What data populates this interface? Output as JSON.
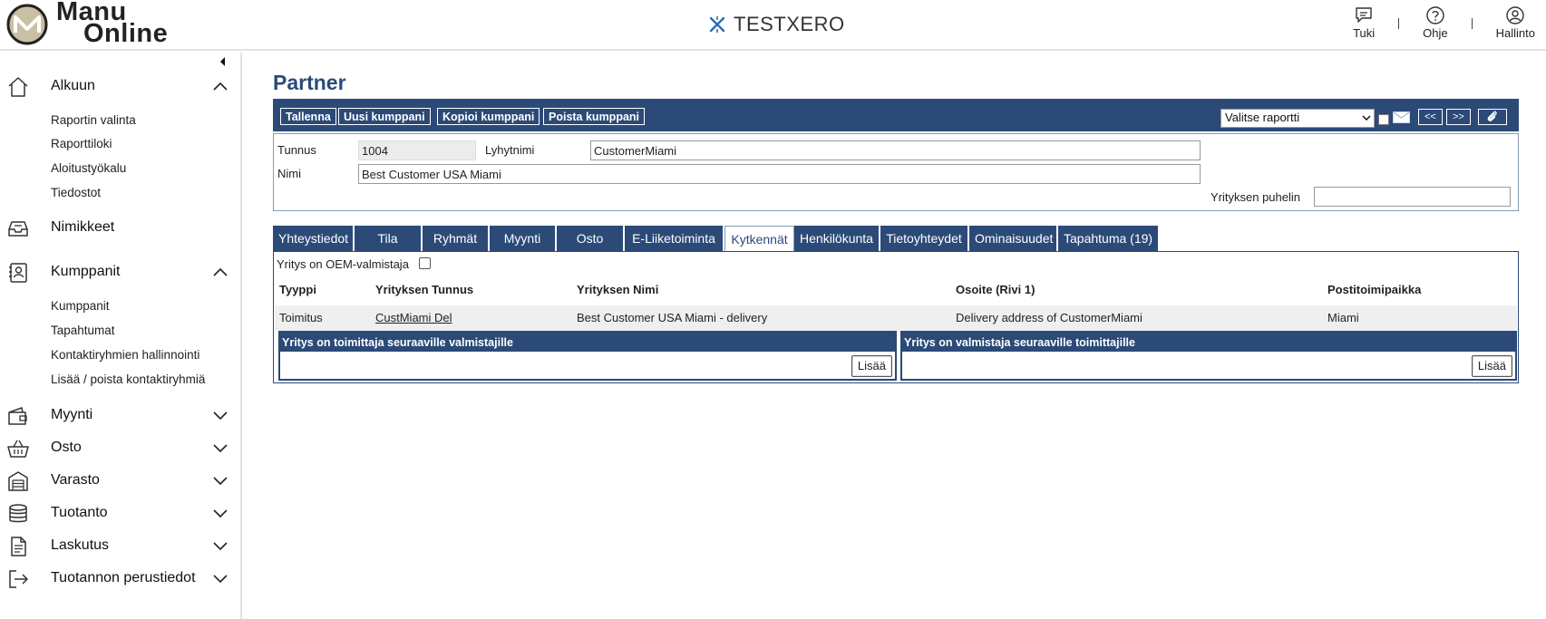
{
  "header": {
    "logo_line1": "Manu",
    "logo_line2": "Online",
    "company": "TESTXERO",
    "links": [
      {
        "label": "Tuki",
        "icon": "chat-icon"
      },
      {
        "label": "Ohje",
        "icon": "help-icon"
      },
      {
        "label": "Hallinto",
        "icon": "user-icon"
      }
    ]
  },
  "sidebar": {
    "sections": [
      {
        "label": "Alkuun",
        "icon": "home-icon",
        "expanded": true,
        "items": [
          "Raportin valinta",
          "Raporttiloki",
          "Aloitustyökalu",
          "Tiedostot"
        ]
      },
      {
        "label": "Nimikkeet",
        "icon": "inbox-icon"
      },
      {
        "label": "Kumppanit",
        "icon": "contacts-icon",
        "expanded": true,
        "items": [
          "Kumppanit",
          "Tapahtumat",
          "Kontaktiryhmien hallinnointi",
          "Lisää / poista kontaktiryhmiä"
        ]
      },
      {
        "label": "Myynti",
        "icon": "wallet-icon"
      },
      {
        "label": "Osto",
        "icon": "basket-icon"
      },
      {
        "label": "Varasto",
        "icon": "warehouse-icon"
      },
      {
        "label": "Tuotanto",
        "icon": "database-icon"
      },
      {
        "label": "Laskutus",
        "icon": "document-icon"
      },
      {
        "label": "Tuotannon perustiedot",
        "icon": "exit-icon"
      }
    ]
  },
  "page": {
    "title": "Partner"
  },
  "toolbar": {
    "save": "Tallenna",
    "new": "Uusi kumppani",
    "copy": "Kopioi kumppani",
    "delete": "Poista kumppani",
    "report_select": "Valitse raportti",
    "prev": "<<",
    "next": ">>"
  },
  "form": {
    "code_label": "Tunnus",
    "code_value": "1004",
    "short_label": "Lyhytnimi",
    "short_value": "CustomerMiami",
    "name_label": "Nimi",
    "name_value": "Best Customer USA Miami",
    "phone_label": "Yrityksen puhelin",
    "phone_value": ""
  },
  "tabs": [
    {
      "label": "Yhteystiedot"
    },
    {
      "label": "Tila"
    },
    {
      "label": "Ryhmät"
    },
    {
      "label": "Myynti"
    },
    {
      "label": "Osto"
    },
    {
      "label": "E-Liiketoiminta"
    },
    {
      "label": "Kytkennät",
      "active": true
    },
    {
      "label": "Henkilökunta"
    },
    {
      "label": "Tietoyhteydet"
    },
    {
      "label": "Ominaisuudet"
    },
    {
      "label": "Tapahtuma (19)"
    }
  ],
  "panel": {
    "oem_label": "Yritys on OEM-valmistaja",
    "columns": [
      "Tyyppi",
      "Yrityksen Tunnus",
      "Yrityksen Nimi",
      "Osoite (Rivi 1)",
      "Postitoimipaikka"
    ],
    "rows": [
      [
        "Toimitus",
        "CustMiami Del",
        "Best Customer USA Miami - delivery",
        "Delivery address of CustomerMiami",
        "Miami"
      ]
    ],
    "left_box_title": "Yritys on toimittaja seuraaville valmistajille",
    "right_box_title": "Yritys on valmistaja seuraaville toimittajille",
    "add_label": "Lisää"
  },
  "colors": {
    "primary": "#2b4a78",
    "title": "#2a4a7c",
    "company_icon": "#2b6cb0"
  }
}
